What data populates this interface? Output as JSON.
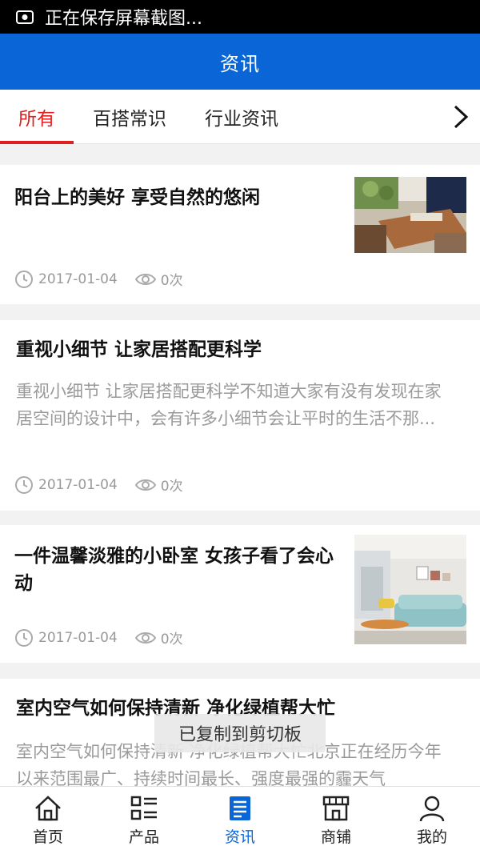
{
  "status_bar": {
    "text": "正在保存屏幕截图..."
  },
  "header": {
    "title": "资讯"
  },
  "tabs": [
    {
      "label": "所有",
      "active": true
    },
    {
      "label": "百搭常识",
      "active": false
    },
    {
      "label": "行业资讯",
      "active": false
    }
  ],
  "articles": [
    {
      "title": "阳台上的美好 享受自然的悠闲",
      "date": "2017-01-04",
      "views": "0次"
    },
    {
      "title": "重视小细节 让家居搭配更科学",
      "desc": "重视小细节 让家居搭配更科学不知道大家有没有发现在家居空间的设计中，会有许多小细节会让平时的生活不那...",
      "date": "2017-01-04",
      "views": "0次"
    },
    {
      "title": "一件温馨淡雅的小卧室 女孩子看了会心动",
      "date": "2017-01-04",
      "views": "0次"
    },
    {
      "title": "室内空气如何保持清新 净化绿植帮大忙",
      "desc": "室内空气如何保持清新 净化绿植帮大忙北京正在经历今年以来范围最广、持续时间最长、强度最强的霾天气"
    }
  ],
  "toast": "已复制到剪切板",
  "bottom_nav": [
    {
      "label": "首页",
      "icon": "home-icon"
    },
    {
      "label": "产品",
      "icon": "product-list-icon"
    },
    {
      "label": "资讯",
      "icon": "news-icon",
      "active": true
    },
    {
      "label": "商铺",
      "icon": "shop-icon"
    },
    {
      "label": "我的",
      "icon": "user-icon"
    }
  ],
  "colors": {
    "brand_blue": "#0a66d6",
    "tab_active_red": "#e02020",
    "meta_gray": "#999999"
  }
}
